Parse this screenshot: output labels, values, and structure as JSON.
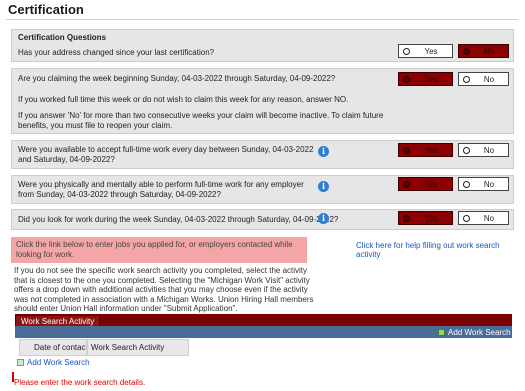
{
  "page": {
    "title": "Certification"
  },
  "header": {
    "label": "Certification Questions"
  },
  "questions": [
    {
      "text": "Has your address changed since your last certification?",
      "yes": "Yes",
      "no": "No",
      "selected": "no"
    },
    {
      "text": "Are you claiming the week beginning Sunday, 04-03-2022 through Saturday, 04-09-2022?",
      "note1": "If you worked full time this week or do not wish to claim this week for any reason, answer NO.",
      "note2": "If you answer 'No' for more than two consecutive weeks your claim will become inactive. To claim future benefits, you must file to reopen your claim.",
      "yes": "Yes",
      "no": "No",
      "selected": "yes"
    },
    {
      "text": "Were you available to accept full-time work every day between Sunday, 04-03-2022 and Saturday, 04-09-2022?",
      "yes": "Yes",
      "no": "No",
      "selected": "yes"
    },
    {
      "text": "Were you physically and mentally able to perform full-time work for any employer from Sunday, 04-03-2022 through Saturday, 04-09-2022?",
      "yes": "Yes",
      "no": "No",
      "selected": "yes"
    },
    {
      "text": "Did you look for work during the week Sunday, 04-03-2022 through Saturday, 04-09-2022?",
      "yes": "Yes",
      "no": "No",
      "selected": "yes"
    }
  ],
  "info_icon": {
    "glyph": "i",
    "icon": "info-icon"
  },
  "alert": {
    "text": "Click the link below to enter jobs you applied for, or employers contacted while looking for work."
  },
  "help_link": {
    "text": "Click here for help filling out work search activity"
  },
  "instructions": "If you do not see the specific work search activity you completed, select the activity that is closest to the one you completed. Selecting the \"Michigan Work Visit\" activity offers a drop down with additional activities that you may choose even if the activity was not completed in association with a Michigan Works. Union Hiring Hall members should enter Union Hall information under \"Submit Application\".",
  "work_search": {
    "tab_label": "Work Search Activity",
    "add_label": "Add Work Search",
    "columns": [
      "Date of contact",
      "Work Search Activity"
    ],
    "add_link": "Add Work Search"
  },
  "error": "Please enter the work search details.",
  "colors": {
    "selected": "#8b0000",
    "bar": "#7a0000",
    "subbar": "#4a6c99",
    "link": "#1b55c0",
    "error": "#e00000",
    "alert_bg": "#f4a6a6"
  }
}
